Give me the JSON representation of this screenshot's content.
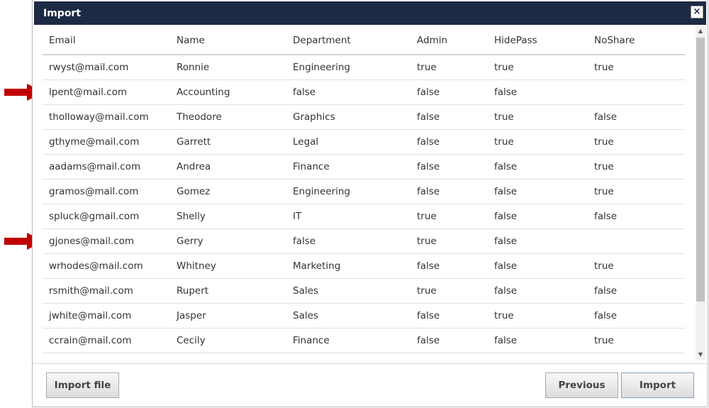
{
  "dialog": {
    "title": "Import",
    "close_label": "×"
  },
  "table": {
    "columns": [
      "Email",
      "Name",
      "Department",
      "Admin",
      "HidePass",
      "NoShare"
    ],
    "rows": [
      [
        "rwyst@mail.com",
        "Ronnie",
        "Engineering",
        "true",
        "true",
        "true"
      ],
      [
        "lpent@mail.com",
        "Accounting",
        "false",
        "false",
        "false",
        ""
      ],
      [
        "tholloway@mail.com",
        "Theodore",
        "Graphics",
        "false",
        "true",
        "false"
      ],
      [
        "gthyme@mail.com",
        "Garrett",
        "Legal",
        "false",
        "true",
        "true"
      ],
      [
        "aadams@mail.com",
        "Andrea",
        "Finance",
        "false",
        "false",
        "true"
      ],
      [
        "gramos@mail.com",
        "Gomez",
        "Engineering",
        "false",
        "false",
        "true"
      ],
      [
        "spluck@gmail.com",
        "Shelly",
        "IT",
        "true",
        "false",
        "false"
      ],
      [
        "gjones@mail.com",
        "Gerry",
        "false",
        "true",
        "false",
        ""
      ],
      [
        "wrhodes@mail.com",
        "Whitney",
        "Marketing",
        "false",
        "false",
        "true"
      ],
      [
        "rsmith@mail.com",
        "Rupert",
        "Sales",
        "true",
        "false",
        "false"
      ],
      [
        "jwhite@mail.com",
        "Jasper",
        "Sales",
        "false",
        "true",
        "false"
      ],
      [
        "ccrain@mail.com",
        "Cecily",
        "Finance",
        "false",
        "false",
        "true"
      ]
    ]
  },
  "buttons": {
    "import_file": "Import file",
    "previous": "Previous",
    "import": "Import"
  },
  "colors": {
    "titlebar": "#1c2a44",
    "annotation_arrow": "#c00000"
  },
  "icons": {
    "close": "close-icon",
    "scroll_up": "chevron-up-icon",
    "scroll_down": "chevron-down-icon",
    "annotation": "red-arrow-icon"
  }
}
